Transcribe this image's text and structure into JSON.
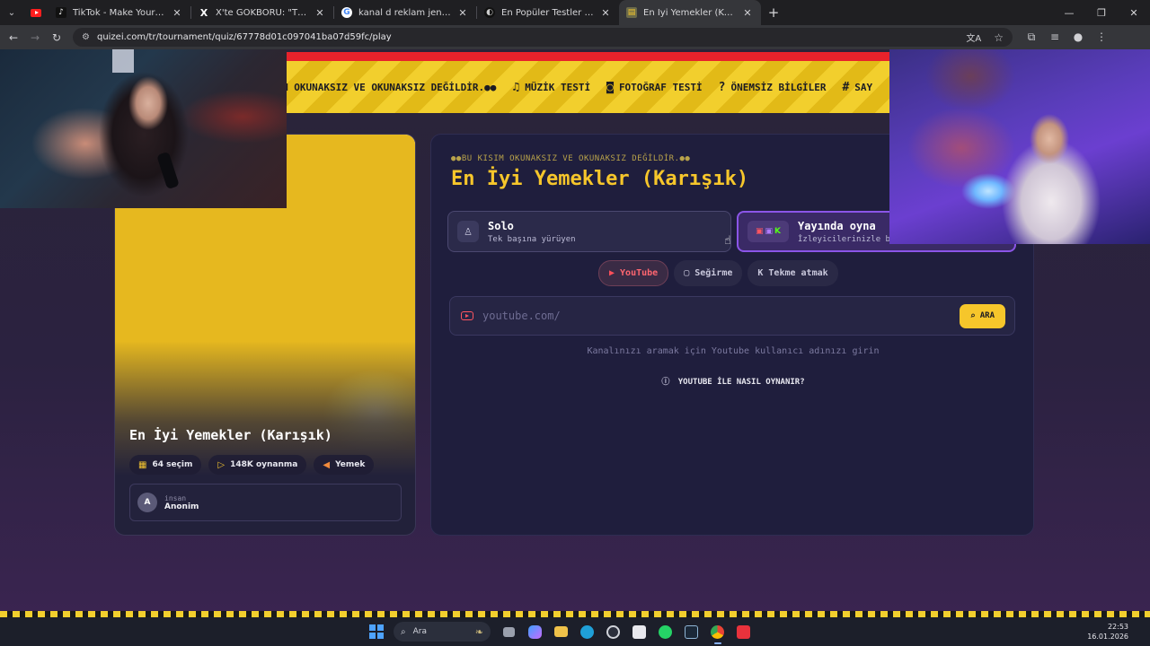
{
  "browser": {
    "tabs": [
      {
        "title": "TikTok - Make Your Day",
        "favicon": "tiktok-icon"
      },
      {
        "title": "X'te GÖKBÖRÜ: \"TÜRKİYE TÜ",
        "favicon": "x-icon"
      },
      {
        "title": "kanal d reklam jeneriği - Googl",
        "favicon": "google-icon"
      },
      {
        "title": "En Popüler Testler ve Eğlenceli",
        "favicon": "quizei-icon"
      },
      {
        "title": "En İyi Yemekler (Karışık) - Tier L",
        "favicon": "quizei-icon",
        "active": true
      }
    ],
    "close_glyph": "✕",
    "new_tab_glyph": "+",
    "url": "quizei.com/tr/tournament/quiz/67778d01c097041ba07d59fc/play"
  },
  "marquee": {
    "items": [
      {
        "icon": "hash-icon",
        "label": "M OKUNAKSIZ VE OKUNAKSIZ DEĞİLDİR.●●"
      },
      {
        "icon": "music-note-icon",
        "label": "MÜZİK TESTİ"
      },
      {
        "icon": "camera-icon",
        "label": "FOTOĞRAF TESTİ"
      },
      {
        "icon": "help-bubble-icon",
        "label": "ÖNEMSİZ BİLGİLER"
      },
      {
        "icon": "hash-icon",
        "label": "SAY"
      }
    ]
  },
  "quiz_card": {
    "title": "En İyi Yemekler (Karışık)",
    "stats": {
      "choices": "64 seçim",
      "plays": "148K oynanma",
      "category": "Yemek"
    },
    "author": {
      "initial": "A",
      "role": "insan",
      "name": "Anonim"
    }
  },
  "main": {
    "overline": "●●BU KISIM OKUNAKSIZ VE OKUNAKSIZ DEĞİLDİR.●●",
    "title": "En İyi Yemekler (Karışık)",
    "modes": [
      {
        "title": "Solo",
        "subtitle": "Tek başına yürüyen"
      },
      {
        "title": "Yayında oyna",
        "subtitle": "İzleyicilerinizle b"
      }
    ],
    "platforms": [
      {
        "label": "YouTube",
        "icon": "youtube-icon",
        "active": true
      },
      {
        "label": "Seğirme",
        "icon": "twitch-icon",
        "active": false
      },
      {
        "label": "Tekme atmak",
        "icon": "kick-icon",
        "active": false
      }
    ],
    "search": {
      "placeholder": "youtube.com/",
      "button": "ARA"
    },
    "hint": "Kanalınızı aramak için Youtube kullanıcı adınızı girin",
    "howto": "YOUTUBE İLE NASIL OYNANIR?"
  },
  "taskbar": {
    "search_label": "Ara",
    "time": "22:53",
    "date": "16.01.2026"
  },
  "colors": {
    "accent_yellow": "#f6c62b",
    "youtube_red": "#ff4f5a",
    "live_purple": "#8b55e8",
    "card_bg": "#1f1e3d"
  }
}
